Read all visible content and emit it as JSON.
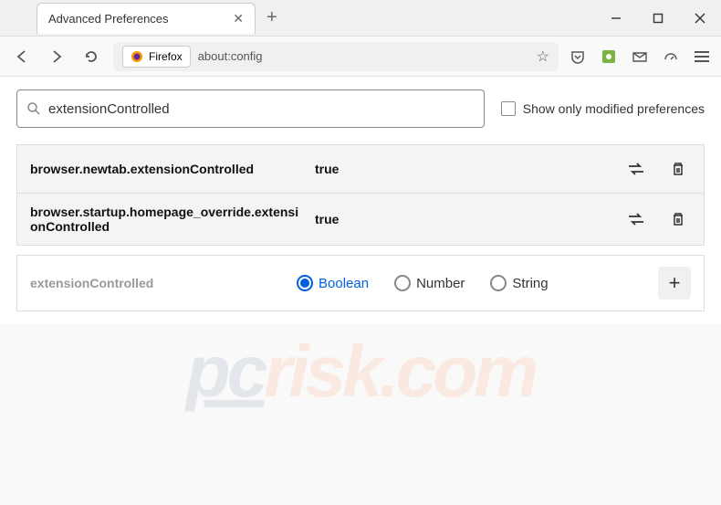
{
  "tab": {
    "title": "Advanced Preferences"
  },
  "address": {
    "label": "Firefox",
    "url": "about:config"
  },
  "search": {
    "value": "extensionControlled",
    "checkbox_label": "Show only modified preferences"
  },
  "prefs": [
    {
      "name": "browser.newtab.extensionControlled",
      "value": "true"
    },
    {
      "name": "browser.startup.homepage_override.extensionControlled",
      "value": "true"
    }
  ],
  "new_pref": {
    "name": "extensionControlled",
    "types": [
      "Boolean",
      "Number",
      "String"
    ],
    "selected": 0
  }
}
